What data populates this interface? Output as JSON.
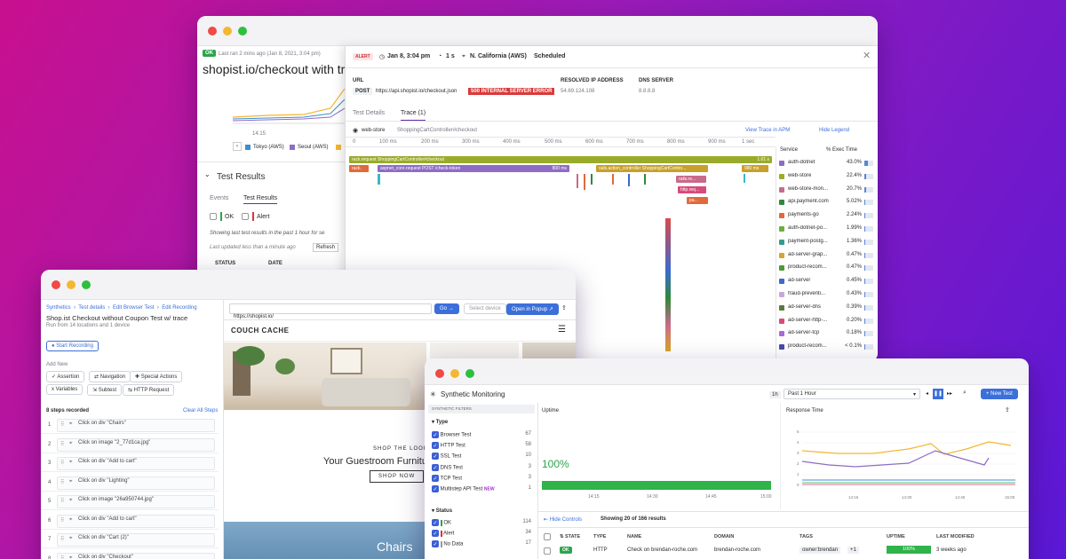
{
  "trace_window": {
    "ok_badge": "OK",
    "last_ran": "Last ran 2 mins ago (Jan 8, 2021, 3:04 pm)",
    "title": "shopist.io/checkout with tra",
    "chart_tick": "14:15",
    "legend": [
      "Tokyo (AWS)",
      "Seoul (AWS)"
    ],
    "test_results_title": "Test Results",
    "tabs": [
      "Events",
      "Test Results"
    ],
    "filter_ok": "OK",
    "filter_alert": "Alert",
    "showing_text": "Showing last test results in the past 1 hour for se",
    "updated_text": "Last updated less than a minute ago",
    "refresh": "Refresh",
    "col_status": "STATUS",
    "col_date": "DATE",
    "alert_badge": "ALERT",
    "run_date": "Jan 8, 3:04 pm",
    "run_duration": "1 s",
    "run_location": "N. California (AWS)",
    "run_type": "Scheduled",
    "url_label": "URL",
    "method": "POST",
    "url": "https://api.shopist.io/checkout.json",
    "error": "500 INTERNAL SERVER ERROR",
    "ip_label": "RESOLVED IP ADDRESS",
    "ip": "54.69.124.108",
    "dns_label": "DNS SERVER",
    "dns": "8.8.8.8",
    "panel_tabs": [
      "Test Details",
      "Trace (1)"
    ],
    "trace_service": "web-store",
    "trace_resource": "ShoppingCartController#checkout",
    "view_trace": "View Trace in APM",
    "hide_legend": "Hide Legend",
    "ruler": [
      "0",
      "100 ms",
      "200 ms",
      "300 ms",
      "400 ms",
      "500 ms",
      "600 ms",
      "700 ms",
      "800 ms",
      "900 ms",
      "1 sec"
    ],
    "bar_labels": {
      "root": "rack.request ShoppingCartController#checkout",
      "root_dur": "1.01 s",
      "b2": "aspnet_core.request POST /check-token",
      "b2_dur": "800 ms",
      "b1": "rack.",
      "b3": "rails.action_controller ShoppingCartContro...",
      "b3_dur": "980 ms",
      "b4": "rails.re...",
      "b5": "http.req...",
      "b6": "pa..."
    },
    "service_header": "Service",
    "exec_header": "% Exec Time",
    "services": [
      {
        "name": "auth-dotnet",
        "pct": "43.0%",
        "color": "#8e6cc4",
        "frac": 0.43
      },
      {
        "name": "web-store",
        "pct": "22.4%",
        "color": "#9aab2a",
        "frac": 0.224
      },
      {
        "name": "web-store-mon...",
        "pct": "20.7%",
        "color": "#c86a8a",
        "frac": 0.207
      },
      {
        "name": "api.payment.com",
        "pct": "5.02%",
        "color": "#2f8a3a",
        "frac": 0.05
      },
      {
        "name": "payments-go",
        "pct": "2.24%",
        "color": "#e06a3a",
        "frac": 0.022
      },
      {
        "name": "auth-dotnet-po...",
        "pct": "1.99%",
        "color": "#6aaf3a",
        "frac": 0.02
      },
      {
        "name": "payment-postg...",
        "pct": "1.36%",
        "color": "#3a9a8a",
        "frac": 0.014
      },
      {
        "name": "ad-server-grap...",
        "pct": "0.47%",
        "color": "#d9a52a",
        "frac": 0.005
      },
      {
        "name": "product-recom...",
        "pct": "0.47%",
        "color": "#4a9a3a",
        "frac": 0.005
      },
      {
        "name": "ad-server",
        "pct": "0.45%",
        "color": "#3a6acf",
        "frac": 0.005
      },
      {
        "name": "fraud-preventi...",
        "pct": "0.43%",
        "color": "#c8a8d8",
        "frac": 0.004
      },
      {
        "name": "ad-server-dns",
        "pct": "0.39%",
        "color": "#5a7a3a",
        "frac": 0.004
      },
      {
        "name": "ad-server-http-...",
        "pct": "0.20%",
        "color": "#d84a7a",
        "frac": 0.002
      },
      {
        "name": "ad-server-tcp",
        "pct": "0.18%",
        "color": "#a86ad8",
        "frac": 0.002
      },
      {
        "name": "product-recom...",
        "pct": "< 0.1%",
        "color": "#4a4aa8",
        "frac": 0.001
      }
    ]
  },
  "recorder_window": {
    "breadcrumb": [
      "Synthetics",
      "Test details",
      "Edit Browser Test",
      "Edit Recording"
    ],
    "title": "Shop.ist Checkout without Coupon Test w/ trace",
    "subtitle": "Run from 14 locations and 1 device",
    "start_recording": "Start Recording",
    "add_new": "Add New",
    "actions": [
      "Assertion",
      "Navigation",
      "Special Actions",
      "Variables",
      "Subtest",
      "HTTP Request"
    ],
    "steps_recorded": "8 steps recorded",
    "clear_all": "Clear All Steps",
    "steps": [
      "Click on div \"Chairs\"",
      "Click on image \"2_77d1ca.jpg\"",
      "Click on div \"Add to cart\"",
      "Click on div \"Lighting\"",
      "Click on image \"26a950744.jpg\"",
      "Click on div \"Add to cart\"",
      "Click on div \"Cart (2)\"",
      "Click on div \"Checkout\""
    ],
    "url_input": "https://shopist.io/",
    "go": "Go",
    "select_device": "Select device",
    "open_popup": "Open in Popup",
    "brand": "COUCH CACHE",
    "shop_the_look": "SHOP THE LOOK",
    "hero": "Your Guestroom Furniture",
    "shop_now": "SHOP NOW",
    "chairs": "Chairs"
  },
  "monitoring_window": {
    "title": "Synthetic Monitoring",
    "time_short": "1h",
    "time_range": "Past 1 Hour",
    "new_test": "+ New Test",
    "filters_header": "SYNTHETIC FILTERS",
    "type_header": "Type",
    "types": [
      {
        "label": "Browser Test",
        "count": "67"
      },
      {
        "label": "HTTP Test",
        "count": "58"
      },
      {
        "label": "SSL Test",
        "count": "10"
      },
      {
        "label": "DNS Test",
        "count": "3"
      },
      {
        "label": "TCP Test",
        "count": "3"
      },
      {
        "label": "Multistep API Test",
        "count": "1"
      }
    ],
    "new_badge": "NEW",
    "status_header": "Status",
    "statuses": [
      {
        "label": "OK",
        "count": "114"
      },
      {
        "label": "Alert",
        "count": "34"
      },
      {
        "label": "No Data",
        "count": "17"
      }
    ],
    "uptime_title": "Uptime",
    "uptime_value": "100%",
    "uptime_ticks": [
      "14:15",
      "14:30",
      "14:45",
      "15:00"
    ],
    "response_title": "Response Time",
    "rt_yticks": [
      "5",
      "4",
      "3",
      "2",
      "1",
      "0"
    ],
    "rt_xticks": [
      "14:15",
      "14:30",
      "14:45",
      "15:00"
    ],
    "hide_controls": "Hide Controls",
    "showing": "Showing 20 of 166 results",
    "columns": [
      "STATE",
      "TYPE",
      "NAME",
      "DOMAIN",
      "TAGS",
      "UPTIME",
      "LAST MODIFIED"
    ],
    "row": {
      "state": "OK",
      "type": "HTTP",
      "name": "Check on brendan-roche.com",
      "domain": "brendan-roche.com",
      "tag": "owner:brendan",
      "tag_more": "+1",
      "uptime": "100%",
      "modified": "3 weeks ago"
    }
  }
}
